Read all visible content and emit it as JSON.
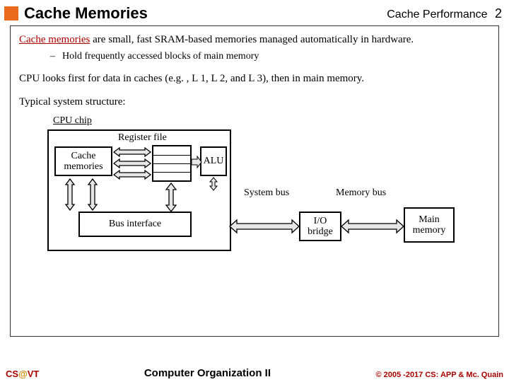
{
  "header": {
    "title": "Cache Memories",
    "topic": "Cache Performance",
    "page_num": "2"
  },
  "body": {
    "intro_red": "Cache memories",
    "intro_rest": " are small, fast SRAM-based memories managed automatically in hardware.",
    "bullet1": "Hold frequently accessed blocks of main memory",
    "para2": "CPU looks first for data in caches (e.g. , L 1, L 2, and L 3), then in main memory.",
    "para3": "Typical system structure:"
  },
  "diagram": {
    "cpu_chip": "CPU chip",
    "reg_file": "Register file",
    "cache": "Cache memories",
    "alu": "ALU",
    "bus_if": "Bus interface",
    "sys_bus": "System bus",
    "mem_bus": "Memory bus",
    "io_bridge": "I/O bridge",
    "main_mem": "Main memory"
  },
  "footer": {
    "left_cs": "CS",
    "left_at": "@",
    "left_vt": "VT",
    "center": "Computer Organization II",
    "right": "© 2005 -2017 CS: APP & Mc. Quain"
  }
}
